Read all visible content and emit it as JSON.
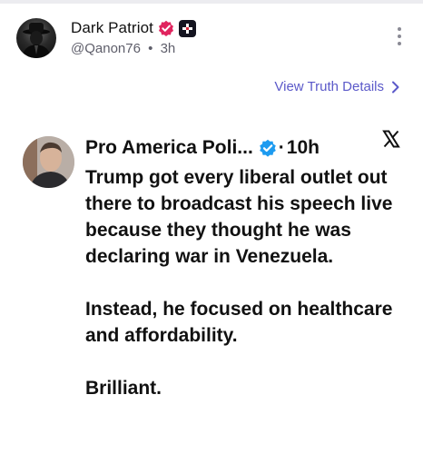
{
  "header": {
    "display_name": "Dark Patriot",
    "handle": "@Qanon76",
    "separator": "•",
    "time": "3h"
  },
  "link": {
    "view_details": "View Truth Details"
  },
  "embed": {
    "name": "Pro America Poli...",
    "separator": "·",
    "time": "10h",
    "paragraphs": [
      "Trump got every liberal outlet out there to broadcast his speech live because they thought he was declaring war in Venezuela.",
      "Instead, he focused on healthcare and affordability.",
      "Brilliant."
    ]
  },
  "colors": {
    "link": "#5b59c9",
    "verified_pink": "#e0245e",
    "verified_blue": "#1d9bf0",
    "handle_gray": "#5e5e6a"
  },
  "icons": {
    "verified": "verified-badge-icon",
    "plus": "plus-badge-icon",
    "menu": "more-vertical-icon",
    "chevron": "chevron-right-icon",
    "embed_verified": "blue-check-icon",
    "x_logo": "x-logo-icon"
  }
}
